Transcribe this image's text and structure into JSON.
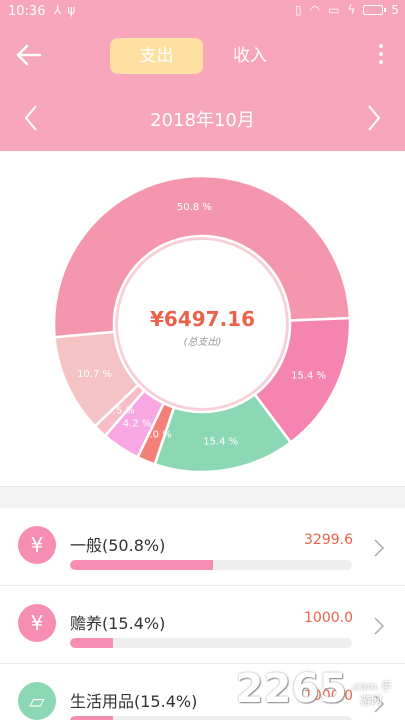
{
  "status_bar": {
    "time": "10:36",
    "battery_level": "5"
  },
  "header": {
    "tabs": [
      {
        "label": "支出",
        "active": true
      },
      {
        "label": "收入",
        "active": false
      }
    ],
    "month": "2018年10月"
  },
  "chart_data": {
    "type": "pie",
    "donut": true,
    "center_value": "¥6497.16",
    "center_caption": "(总支出)",
    "slices": [
      {
        "label": "50.8 %",
        "value": 50.8,
        "color": "#f497ae"
      },
      {
        "label": "15.4 %",
        "value": 15.4,
        "color": "#f585b0"
      },
      {
        "label": "15.4 %",
        "value": 15.4,
        "color": "#8dd8b4"
      },
      {
        "label": "2.0 %",
        "value": 2.0,
        "color": "#f4807a"
      },
      {
        "label": "4.2 %",
        "value": 4.2,
        "color": "#f7a8e2"
      },
      {
        "label": "1.5 %",
        "value": 1.5,
        "color": "#f7bcc6"
      },
      {
        "label": "10.7 %",
        "value": 10.7,
        "color": "#f5c3c3"
      }
    ]
  },
  "list": [
    {
      "icon": "yen-icon",
      "glyph": "¥",
      "name": "一般(50.8%)",
      "amount": "3299.6",
      "fraction": 0.508,
      "color": "#f58eb2"
    },
    {
      "icon": "yen-cycle-icon",
      "glyph": "¥",
      "name": "赡养(15.4%)",
      "amount": "1000.0",
      "fraction": 0.154,
      "color": "#f58eb2"
    },
    {
      "icon": "soap-icon",
      "glyph": "▱",
      "name": "生活用品(15.4%)",
      "amount": "1000.0",
      "fraction": 0.154,
      "color": "#8dd8b4"
    }
  ],
  "watermark": {
    "logo": "2265",
    "sub": ".com 手游网"
  }
}
